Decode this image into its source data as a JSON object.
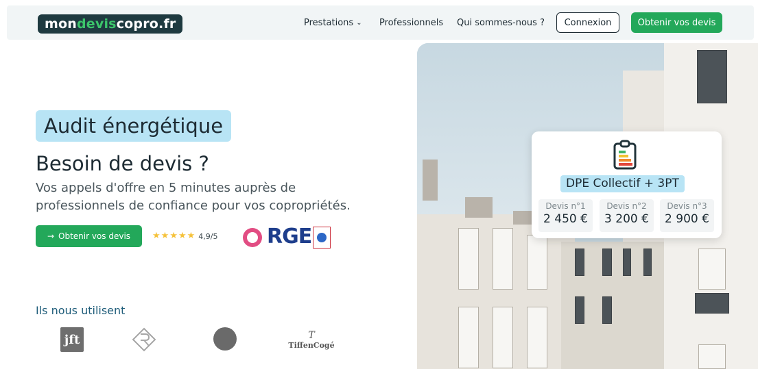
{
  "header": {
    "logo": {
      "part1": "mon",
      "part2": "devis",
      "part3": "copro.fr"
    },
    "nav": [
      {
        "label": "Prestations"
      },
      {
        "label": "Professionnels"
      },
      {
        "label": "Qui sommes-nous ?"
      }
    ],
    "login_label": "Connexion",
    "cta_label": "Obtenir vos devis"
  },
  "hero": {
    "badge": "Audit énergétique",
    "title": "Besoin de devis ?",
    "subtitle": "Vos appels d'offre en 5 minutes auprès de professionnels de confiance pour vos copropriétés.",
    "cta_label": "Obtenir vos devis",
    "rating": "4,9/5",
    "rge_label": "RGE",
    "users_title": "Ils nous utilisent"
  },
  "partners": {
    "jft": "jft",
    "tiffen_top": "T",
    "tiffen_name": "TiffenCogé"
  },
  "card": {
    "title": "DPE Collectif + 3PT",
    "quotes": [
      {
        "label": "Devis n°1",
        "value": "2 450 €"
      },
      {
        "label": "Devis n°2",
        "value": "3 200 €"
      },
      {
        "label": "Devis n°3",
        "value": "2 900 €"
      }
    ]
  },
  "colors": {
    "brand_green": "#23a85a",
    "badge_blue": "#b8e4f5",
    "logo_dark": "#1e3a40"
  },
  "icons": [
    "chevron-down-icon",
    "arrow-right-icon",
    "star-icon",
    "clipboard-energy-icon"
  ]
}
